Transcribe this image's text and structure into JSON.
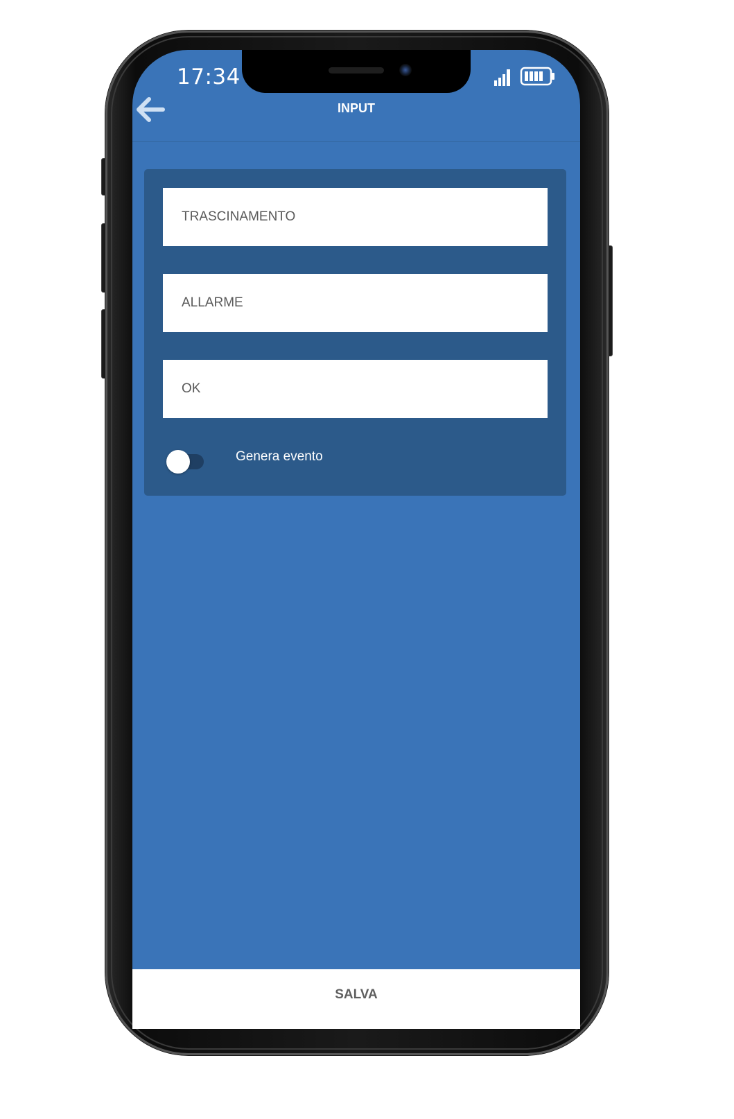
{
  "status_bar": {
    "time": "17:34",
    "signal_icon": "cellular-signal-icon",
    "battery_icon": "battery-icon"
  },
  "header": {
    "title": "INPUT",
    "back_icon": "arrow-left-icon"
  },
  "form": {
    "fields": [
      {
        "value": "TRASCINAMENTO"
      },
      {
        "value": "ALLARME"
      },
      {
        "value": "OK"
      }
    ],
    "toggle": {
      "label": "Genera evento",
      "checked": false
    }
  },
  "footer": {
    "save_label": "SALVA"
  },
  "colors": {
    "screen_background": "#3a74b8",
    "card_background": "#2c5a8a",
    "field_background": "#ffffff",
    "field_text": "#5a5a5a",
    "toggle_track": "#1f3f63"
  }
}
